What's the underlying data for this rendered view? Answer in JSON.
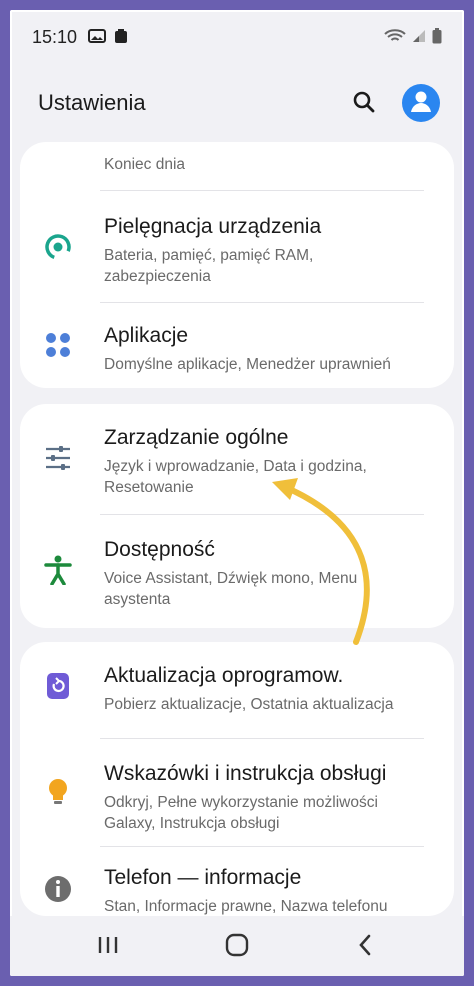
{
  "status_bar": {
    "time": "15:10"
  },
  "app_bar": {
    "title": "Ustawienia"
  },
  "partial_item": {
    "subtitle": "Koniec dnia"
  },
  "items": [
    {
      "title": "Pielęgnacja urządzenia",
      "subtitle": "Bateria, pamięć, pamięć RAM, zabezpieczenia"
    },
    {
      "title": "Aplikacje",
      "subtitle": "Domyślne aplikacje, Menedżer uprawnień"
    },
    {
      "title": "Zarządzanie ogólne",
      "subtitle": "Język i wprowadzanie, Data i godzina, Resetowanie"
    },
    {
      "title": "Dostępność",
      "subtitle": "Voice Assistant, Dźwięk mono, Menu asystenta"
    },
    {
      "title": "Aktualizacja oprogramow.",
      "subtitle": "Pobierz aktualizacje, Ostatnia aktualizacja"
    },
    {
      "title": "Wskazówki i instrukcja obsługi",
      "subtitle": "Odkryj, Pełne wykorzystanie możliwości Galaxy, Instrukcja obsługi"
    },
    {
      "title": "Telefon — informacje",
      "subtitle": "Stan, Informacje prawne, Nazwa telefonu"
    }
  ],
  "colors": {
    "frame": "#6a5fb0",
    "accent_blue": "#2a86f0",
    "device_care": "#1aa58d",
    "apps": "#4d7fd8",
    "accessibility": "#1d8a3c",
    "software_update": "#6f5bd6",
    "tips": "#f2a51f",
    "about": "#6d6d6d",
    "annotation_arrow": "#f0bf3a"
  }
}
